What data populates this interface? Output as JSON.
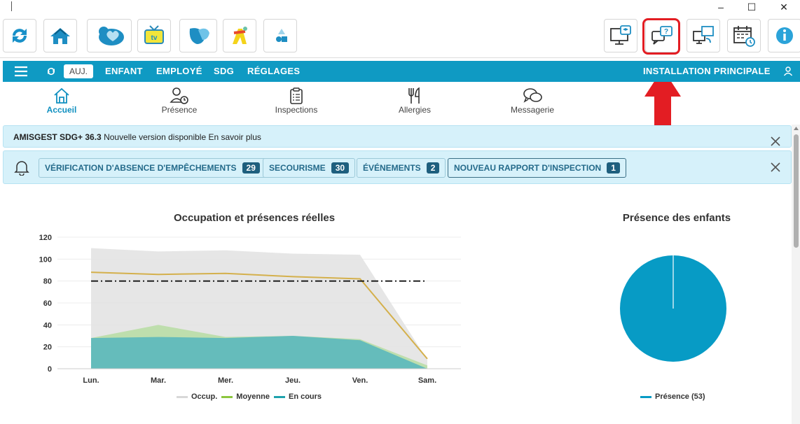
{
  "window": {
    "controls": {
      "minimize": "–",
      "maximize": "☐",
      "close": "✕"
    }
  },
  "toolbar": {
    "left_buttons": [
      "refresh-icon",
      "home-icon",
      "cloud-heart-icon",
      "tv-icon",
      "butterfly-icon",
      "kids-icon",
      "shapes-icon"
    ],
    "right_buttons": [
      "monitor-graduate-icon",
      "chat-help-icon",
      "monitor-sync-icon",
      "calendar-clock-icon",
      "info-icon"
    ],
    "highlight_color": "#e31d23"
  },
  "nav": {
    "today": "AUJ.",
    "items": [
      "ENFANT",
      "EMPLOYÉ",
      "SDG",
      "RÉGLAGES"
    ],
    "installation": "INSTALLATION PRINCIPALE",
    "color": "#0f9ac3"
  },
  "icons": [
    {
      "label": "Accueil",
      "icon": "home-outline-icon",
      "active": true
    },
    {
      "label": "Présence",
      "icon": "user-clock-icon",
      "active": false
    },
    {
      "label": "Inspections",
      "icon": "clipboard-icon",
      "active": false
    },
    {
      "label": "Allergies",
      "icon": "cutlery-icon",
      "active": false
    },
    {
      "label": "Messagerie",
      "icon": "chat-bubbles-icon",
      "active": false
    }
  ],
  "banner_update": {
    "product": "AMISGEST SDG+ 36.3",
    "message": "Nouvelle version disponible",
    "link": "En savoir plus"
  },
  "notifications": [
    {
      "label": "VÉRIFICATION D'ABSENCE D'EMPÊCHEMENTS",
      "count": "29"
    },
    {
      "label": "SECOURISME",
      "count": "30"
    },
    {
      "label": "ÉVÉNEMENTS",
      "count": "2"
    },
    {
      "label": "NOUVEAU RAPPORT D'INSPECTION",
      "count": "1"
    }
  ],
  "chart_data": [
    {
      "type": "area",
      "title": "Occupation et présences réelles",
      "categories": [
        "Lun.",
        "Mar.",
        "Mer.",
        "Jeu.",
        "Ven.",
        "Sam."
      ],
      "ylim": [
        0,
        120
      ],
      "yticks": [
        0,
        20,
        40,
        60,
        80,
        100,
        120
      ],
      "series": [
        {
          "name": "Occup.",
          "kind": "area",
          "color": "#e2e2e2",
          "values": [
            110,
            107,
            108,
            105,
            104,
            8
          ]
        },
        {
          "name": "Moyenne",
          "kind": "area",
          "color": "#b9dda6",
          "values": [
            28,
            40,
            29,
            30,
            27,
            3
          ]
        },
        {
          "name": "En cours",
          "kind": "area",
          "color": "#5bb8bd",
          "values": [
            28,
            29,
            28,
            30,
            26,
            0
          ]
        },
        {
          "kind": "line",
          "color": "#d4b04c",
          "values": [
            88,
            86,
            87,
            84,
            82,
            9
          ]
        },
        {
          "kind": "dashdot",
          "color": "#111111",
          "values": [
            80,
            80,
            80,
            80,
            80,
            80
          ]
        }
      ],
      "legend_position": "bottom"
    },
    {
      "type": "pie",
      "title": "Présence des enfants",
      "slices": [
        {
          "name": "Présence (53)",
          "value": 53,
          "color": "#079bc5"
        }
      ],
      "legend_position": "bottom"
    }
  ]
}
